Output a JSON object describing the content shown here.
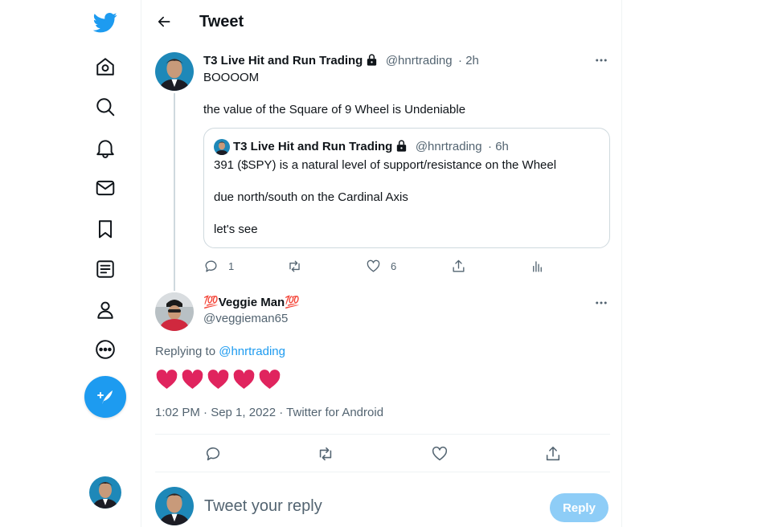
{
  "header": {
    "title": "Tweet"
  },
  "sidebar": {
    "items": [
      {
        "name": "twitter-logo",
        "icon": "twitter-bird-icon"
      },
      {
        "name": "home",
        "icon": "home-icon"
      },
      {
        "name": "explore",
        "icon": "search-icon"
      },
      {
        "name": "notifications",
        "icon": "bell-icon"
      },
      {
        "name": "messages",
        "icon": "mail-icon"
      },
      {
        "name": "bookmarks",
        "icon": "bookmark-icon"
      },
      {
        "name": "lists",
        "icon": "list-icon"
      },
      {
        "name": "profile",
        "icon": "person-icon"
      },
      {
        "name": "more",
        "icon": "more-circle-icon"
      }
    ],
    "compose_icon": "feather-plus-icon"
  },
  "parent_tweet": {
    "display_name": "T3 Live Hit and Run Trading",
    "handle": "@hnrtrading",
    "time": "· 2h",
    "text_line1": "BOOOOM",
    "text_line2": "the value of the Square of 9 Wheel is Undeniable",
    "quote": {
      "display_name": "T3 Live Hit and Run Trading",
      "handle": "@hnrtrading",
      "time": "· 6h",
      "line1": "391 ($SPY) is a natural level of support/resistance on the Wheel",
      "line2": "due north/south on the Cardinal Axis",
      "line3": "let's see"
    },
    "replies": "1",
    "likes": "6"
  },
  "main_tweet": {
    "display_name_prefix": "💯",
    "display_name": "Veggie Man",
    "display_name_suffix": "💯",
    "handle": "@veggieman65",
    "replying_to_label": "Replying to",
    "replying_to_handle": "@hnrtrading",
    "heart_count": 5,
    "timestamp": "1:02 PM · Sep 1, 2022 · Twitter for Android"
  },
  "reply_box": {
    "placeholder": "Tweet your reply",
    "button_label": "Reply"
  },
  "colors": {
    "accent": "#1d9bf0",
    "text": "#0f1419",
    "muted": "#536471",
    "heart": "#e0245e",
    "reply_button_disabled": "#8ecdf7"
  }
}
